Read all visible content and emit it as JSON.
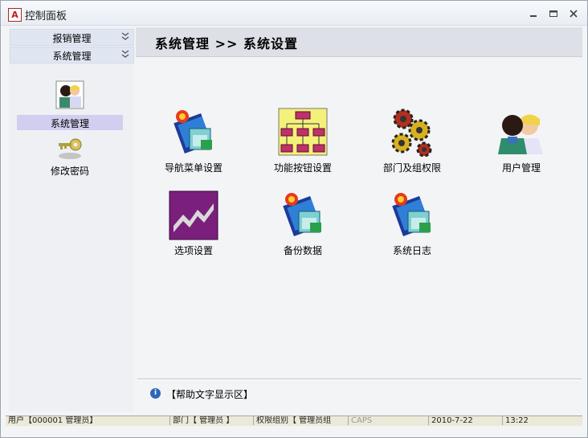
{
  "window": {
    "title": "控制面板",
    "app_icon_letter": "A"
  },
  "sidebar": {
    "sections": [
      {
        "label": "报销管理",
        "chevron": "double-chevron-down-icon"
      },
      {
        "label": "系统管理",
        "chevron": "double-chevron-down-icon"
      }
    ],
    "items": [
      {
        "label": "系统管理",
        "icon": "users-icon",
        "selected": true
      },
      {
        "label": "修改密码",
        "icon": "key-icon",
        "selected": false
      }
    ]
  },
  "header": {
    "breadcrumb": "系统管理 >> 系统设置"
  },
  "tiles": [
    {
      "label": "导航菜单设置",
      "icon": "setup-icon"
    },
    {
      "label": "功能按钮设置",
      "icon": "org-chart-icon"
    },
    {
      "label": "部门及组权限",
      "icon": "gears-icon"
    },
    {
      "label": "用户管理",
      "icon": "users-icon"
    },
    {
      "label": "选项设置",
      "icon": "chart-icon"
    },
    {
      "label": "备份数据",
      "icon": "setup-icon"
    },
    {
      "label": "系统日志",
      "icon": "setup-icon"
    }
  ],
  "help": {
    "text": "【帮助文字显示区】"
  },
  "status": {
    "user": "用户【000001 管理员】",
    "dept": "部门【 管理员 】",
    "group": "权限组别【 管理员组",
    "caps": "CAPS",
    "date": "2010-7-22",
    "time": "13:22"
  },
  "colors": {
    "selected_bg": "#d2ceef",
    "header_bg": "#dde1e7",
    "accordion_bg": "#dfe6f1"
  }
}
